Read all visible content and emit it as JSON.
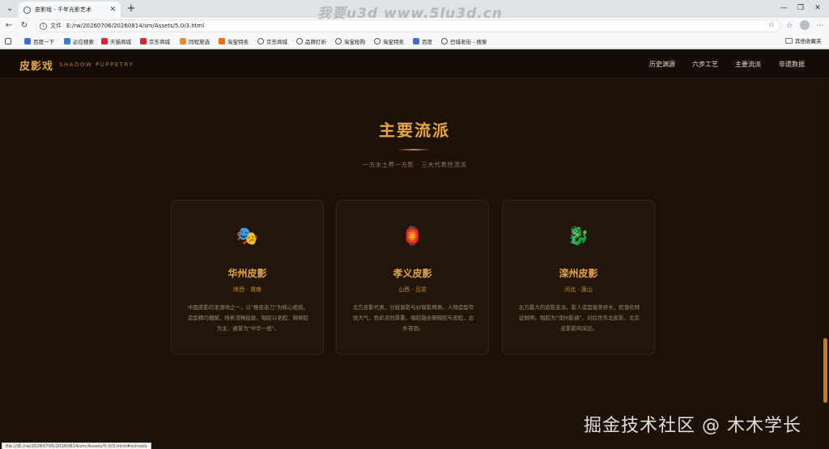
{
  "browser": {
    "tab_title": "皮影戏 - 千年光影艺术",
    "url_scheme": "文件",
    "url": "E:/rw/20260706/20260814/sm/Assets/5.0/3.html",
    "bookmarks": [
      "百度一下",
      "必应搜索",
      "天猫商城",
      "京东商城",
      "同程旅选",
      "淘宝特卖",
      "京东商城",
      "品牌打折",
      "淘宝抢购",
      "淘宝特卖",
      "百度",
      "巴城老街 - 搜索"
    ],
    "bookmark_colors": [
      "#3b6fd6",
      "#3a7bd5",
      "#d7282f",
      "#d7282f",
      "#f08a24",
      "#ff6a00",
      "#555555",
      "#555555",
      "#555555",
      "#555555",
      "#3b6fd6",
      "#555555"
    ],
    "other_bookmarks": "其他收藏夹",
    "status_url": "file:///E:/rw/20260706/20260814/sm/Assets/5.0/3.html#schools"
  },
  "site": {
    "logo_cn": "皮影戏",
    "logo_en": "SHADOW PUPPETRY",
    "nav": [
      "历史渊源",
      "六步工艺",
      "主要流派",
      "非遗数据"
    ]
  },
  "section": {
    "title": "主要流派",
    "subtitle": "一方水土养一方影 · 三大代表性流派"
  },
  "cards": [
    {
      "icon": "🎭",
      "title": "华州皮影",
      "region": "陕西 · 渭南",
      "desc": "中国皮影的发源地之一，以\"推皮走刀\"为核心绝技。造型精巧细腻，线条流畅挺拔，唱腔以老腔、碗碗腔为主，被誉为\"中华一绝\"。"
    },
    {
      "icon": "🏮",
      "title": "孝义皮影",
      "region": "山西 · 吕梁",
      "desc": "北方皮影代表，分纸窗影与纱窗影两类。人物造型夸张大气，色彩浓烈厚重，唱腔融合碗碗腔与皮腔，古朴苍劲。"
    },
    {
      "icon": "🐉",
      "title": "滦州皮影",
      "region": "河北 · 唐山",
      "desc": "北方最大的皮影支派，影人造型俊美修长，脸谱化特征鲜明。唱腔为\"滦州影调\"，对后世东北皮影、北京皮影影响深远。"
    }
  ],
  "watermarks": {
    "top": "我要u3d  www.5lu3d.cn",
    "bottom": "掘金技术社区 @ 木木学长"
  }
}
